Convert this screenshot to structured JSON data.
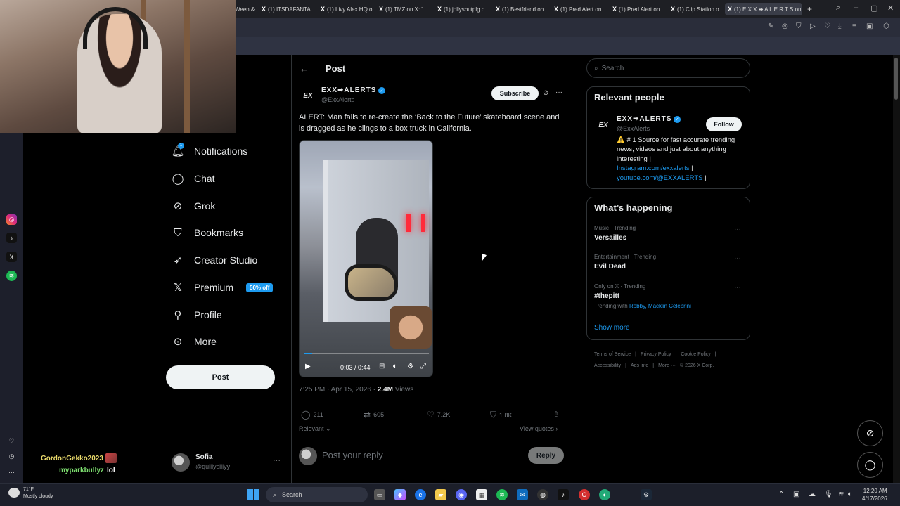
{
  "browser": {
    "tabs": [
      {
        "label": "Ween &"
      },
      {
        "label": "(1) ITSDAFANTA"
      },
      {
        "label": "(1) Livy Alex HQ o"
      },
      {
        "label": "(1) TMZ on X: \""
      },
      {
        "label": "(1) jollysbutplg o"
      },
      {
        "label": "(1) Bestfriend on"
      },
      {
        "label": "(1) Pred Alert on"
      },
      {
        "label": "(1) Pred Alert on"
      },
      {
        "label": "(1) Clip Station o"
      },
      {
        "label": "(1) E X X ➡ A L E R T S on"
      }
    ],
    "newtab_glyph": "+"
  },
  "nav": {
    "notifications": "Notifications",
    "notifications_badge": "1",
    "chat": "Chat",
    "grok": "Grok",
    "bookmarks": "Bookmarks",
    "creator_studio": "Creator Studio",
    "premium": "Premium",
    "premium_badge": "50% off",
    "profile": "Profile",
    "more": "More",
    "post_button": "Post"
  },
  "account": {
    "name": "Sofia",
    "handle": "@quillysillyy",
    "menu": "···"
  },
  "stream_chat": [
    {
      "user": "GordonGekko2023",
      "color": "#e8d86a",
      "message": ""
    },
    {
      "user": "myparkbullyz",
      "color": "#7ee070",
      "message": "lol"
    }
  ],
  "post": {
    "header_title": "Post",
    "author_logo": "EX",
    "author_name": "EXX➡ALERTS",
    "author_handle": "@ExxAlerts",
    "subscribe_label": "Subscribe",
    "text": "ALERT: Man fails to re-create the ‘Back to the Future’ skateboard scene and is dragged as he clings to a box truck in California.",
    "video": {
      "time": "0:03 / 0:44",
      "progress_fraction": 0.07
    },
    "timestamp": "7:25 PM · Apr 15, 2026 · ",
    "views_count": "2.4M",
    "views_label": " Views",
    "stats": {
      "replies": "211",
      "reposts": "605",
      "likes": "7.2K",
      "bookmarks": "1.8K"
    },
    "relevant_label": "Relevant",
    "view_quotes_label": "View quotes",
    "reply_placeholder": "Post your reply",
    "reply_button": "Reply"
  },
  "sidebar": {
    "search_placeholder": "Search",
    "relevant_people_title": "Relevant people",
    "person": {
      "logo": "EX",
      "name": "EXX➡ALERTS",
      "handle": "@ExxAlerts",
      "follow_label": "Follow",
      "bio_text": "⚠️ # 1 Source for fast accurate trending news, videos and just about anything interesting |",
      "bio_link1": "Instagram.com/exxalerts",
      "bio_sep": " |",
      "bio_link2": "youtube.com/@EXXALERTS",
      "bio_end": " |"
    },
    "whats_happening_title": "What’s happening",
    "trends": [
      {
        "meta": "Music · Trending",
        "name": "Versailles"
      },
      {
        "meta": "Entertainment · Trending",
        "name": "Evil Dead"
      },
      {
        "meta": "Only on X · Trending",
        "name": "#thepitt"
      }
    ],
    "trending_with_label": "Trending with ",
    "trending_with_names": "Robby, Macklin Celebrini",
    "show_more": "Show more",
    "footer": [
      "Terms of Service",
      "|",
      "Privacy Policy",
      "|",
      "Cookie Policy",
      "|",
      "Accessibility",
      "|",
      "Ads info",
      "|",
      "More ···",
      "© 2026 X Corp."
    ]
  },
  "taskbar": {
    "temperature": "71°F",
    "weather": "Mostly cloudy",
    "search_label": "Search",
    "time": "12:20 AM",
    "date": "4/17/2026"
  },
  "colors": {
    "accent": "#1d9bf0",
    "background": "#000000",
    "border": "#2f3336",
    "muted_text": "#71767b"
  }
}
